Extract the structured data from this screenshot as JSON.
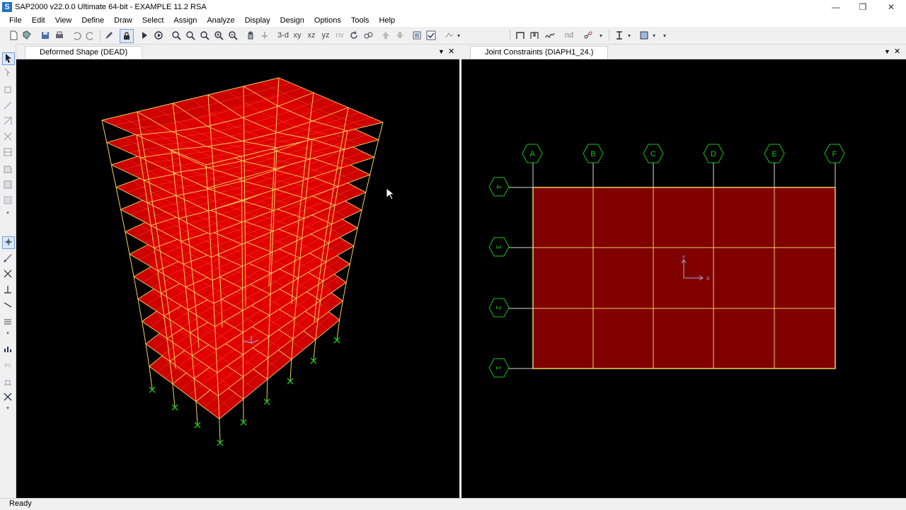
{
  "window": {
    "title": "SAP2000 v22.0.0 Ultimate 64-bit - EXAMPLE 11.2 RSA",
    "app_icon_letter": "S",
    "controls": [
      "minimize-icon",
      "restore-icon",
      "close-icon"
    ]
  },
  "menu": [
    "File",
    "Edit",
    "View",
    "Define",
    "Draw",
    "Select",
    "Assign",
    "Analyze",
    "Display",
    "Design",
    "Options",
    "Tools",
    "Help"
  ],
  "toolbar": {
    "view_3d": "3-d",
    "view_xy": "xy",
    "view_xz": "xz",
    "view_yz": "yz",
    "view_nv": "nv",
    "nd": "nd",
    "icons": [
      "new-icon",
      "open-icon",
      "save-icon",
      "print-icon",
      "undo-icon",
      "redo-icon",
      "pencil-icon",
      "lock-icon",
      "run-icon",
      "run-options-icon",
      "zoom-window-icon",
      "zoom-restore-icon",
      "zoom-in-icon",
      "zoom-in-step-icon",
      "zoom-out-icon",
      "pan-icon",
      "rotate-icon",
      "refresh-icon",
      "perspective-icon",
      "up-icon",
      "down-icon",
      "object-shrink-icon",
      "check-icon",
      "set-display-icon"
    ]
  },
  "left_panel": {
    "tab_title": "Deformed Shape (DEAD)"
  },
  "right_panel": {
    "tab_title": "Joint Constraints (DIAPH1_24.)",
    "grid_x_labels": [
      "A",
      "B",
      "C",
      "D",
      "E",
      "F"
    ],
    "grid_y_labels": [
      "4",
      "3",
      "2",
      "1"
    ],
    "axis_y_label": "Y",
    "axis_x_label": "X"
  },
  "colors": {
    "model_fill": "#e00000",
    "plan_fill": "#800000",
    "frame_line": "#f0d060",
    "grid_bubble": "#18c018",
    "support": "#20c020"
  },
  "status": {
    "text": "Ready"
  }
}
